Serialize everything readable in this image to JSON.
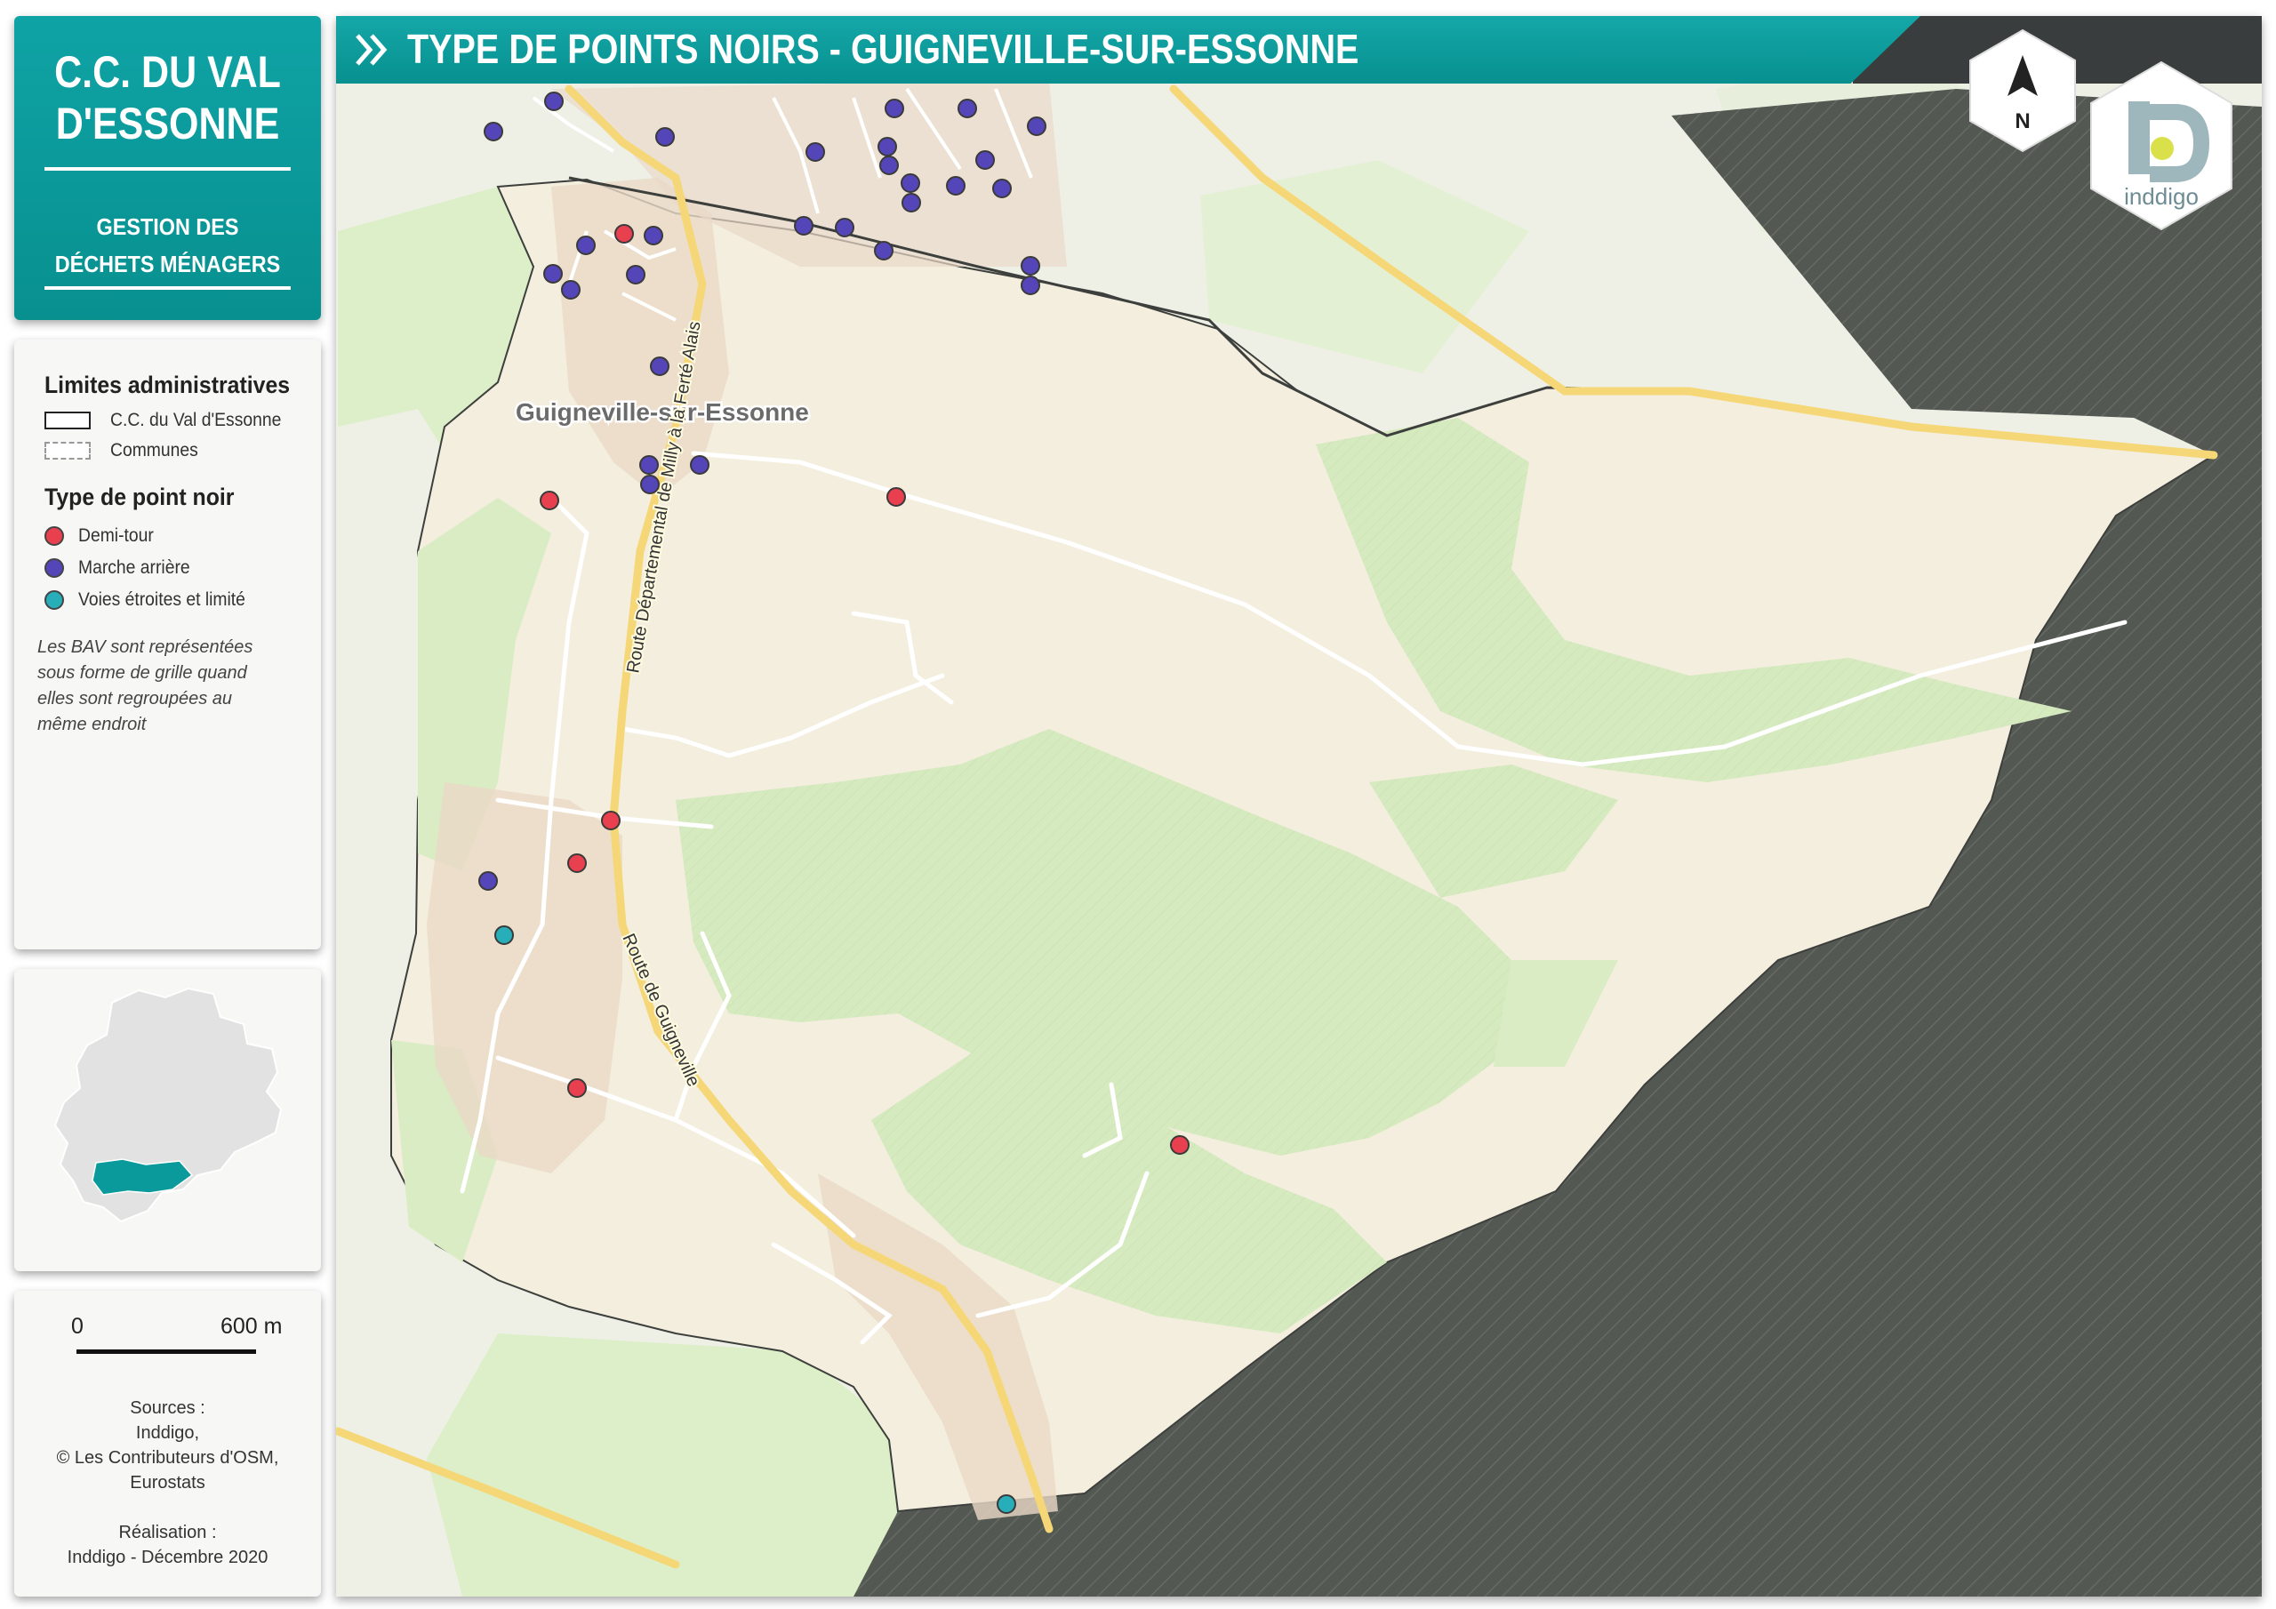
{
  "title_card": {
    "org_line1": "C.C. DU VAL",
    "org_line2": "D'ESSONNE",
    "sub_line1": "GESTION DES",
    "sub_line2": "DÉCHETS MÉNAGERS"
  },
  "banner": {
    "title": "TYPE DE POINTS NOIRS - GUIGNEVILLE-SUR-ESSONNE"
  },
  "legend": {
    "admin_heading": "Limites administratives",
    "admin_items": [
      {
        "label": "C.C. du Val d'Essonne",
        "style": "solid"
      },
      {
        "label": "Communes",
        "style": "dashed"
      }
    ],
    "type_heading": "Type de point noir",
    "type_items": [
      {
        "label": "Demi-tour",
        "color": "#e8404e"
      },
      {
        "label": "Marche arrière",
        "color": "#5446b8"
      },
      {
        "label": "Voies étroites et limité",
        "color": "#27aeb8"
      }
    ],
    "note": "Les BAV sont représentées sous forme de grille quand elles sont regroupées au même endroit"
  },
  "scale": {
    "start": "0",
    "end": "600 m"
  },
  "sources": {
    "label": "Sources :",
    "line1": "Inddigo,",
    "line2": "© Les Contributeurs d'OSM,",
    "line3": "Eurostats",
    "credit_label": "Réalisation :",
    "credit": "Inddigo - Décembre 2020"
  },
  "map": {
    "place_label": "Guigneville-sur-Essonne",
    "road_label_1": "Route Départemental de Milly à la Ferté Alais",
    "road_label_2": "Route de Guigneville",
    "north_label": "N",
    "brand": "inddigo",
    "colors": {
      "commune_fill": "#f3eedd",
      "forest": "#d9ecc3",
      "outside": "#52574f",
      "road_major": "#f5d777"
    }
  }
}
